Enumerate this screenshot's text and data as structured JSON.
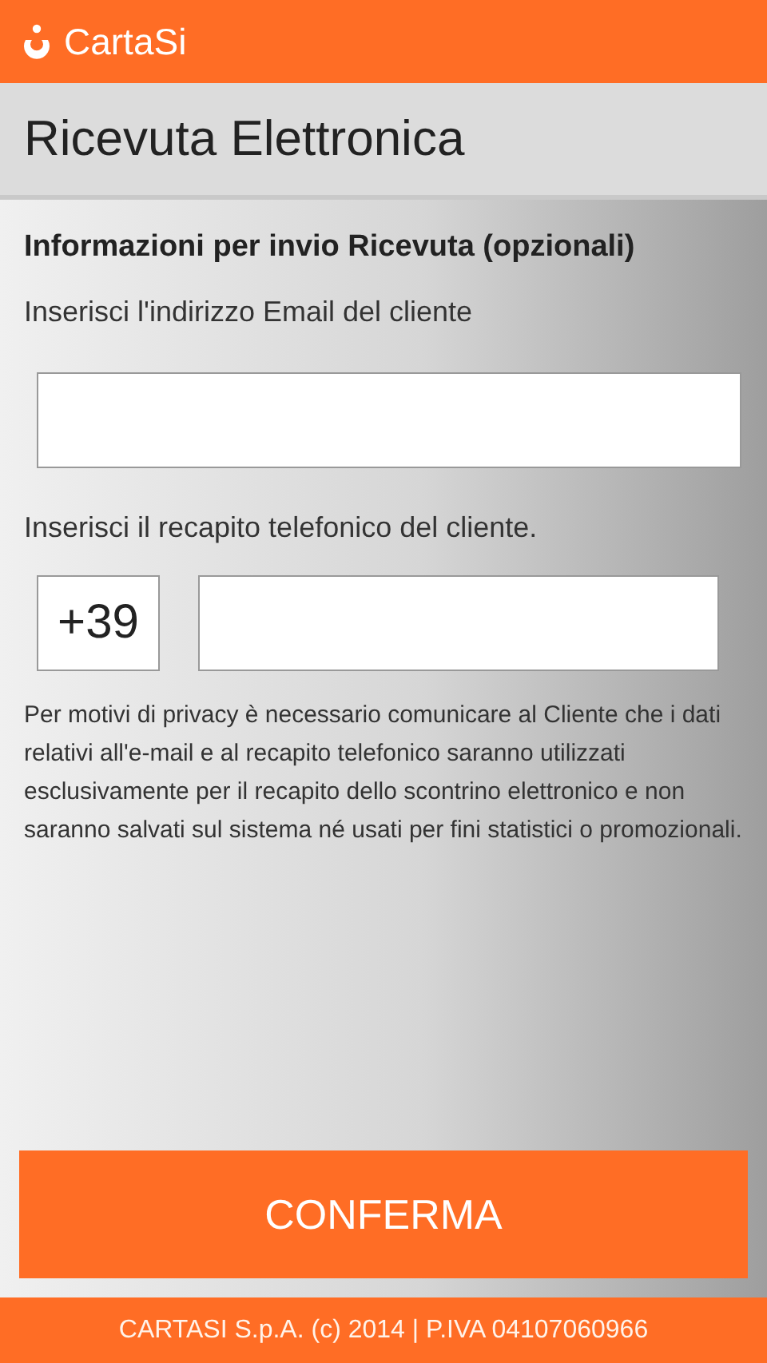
{
  "app_bar": {
    "brand": "CartaSi"
  },
  "page_title": "Ricevuta Elettronica",
  "form": {
    "section_title": "Informazioni per invio Ricevuta (opzionali)",
    "email_label": "Inserisci l'indirizzo Email del cliente",
    "phone_label": "Inserisci il recapito telefonico del cliente.",
    "phone_prefix": "+39",
    "privacy_note": "Per motivi di privacy è necessario comunicare al Cliente che i dati relativi all'e-mail e al recapito telefonico saranno utilizzati esclusivamente per il recapito dello scontrino elettronico e non saranno salvati sul sistema né usati per fini statistici o promozionali."
  },
  "confirm_button": "CONFERMA",
  "footer": "CARTASI S.p.A. (c) 2014 | P.IVA 04107060966"
}
